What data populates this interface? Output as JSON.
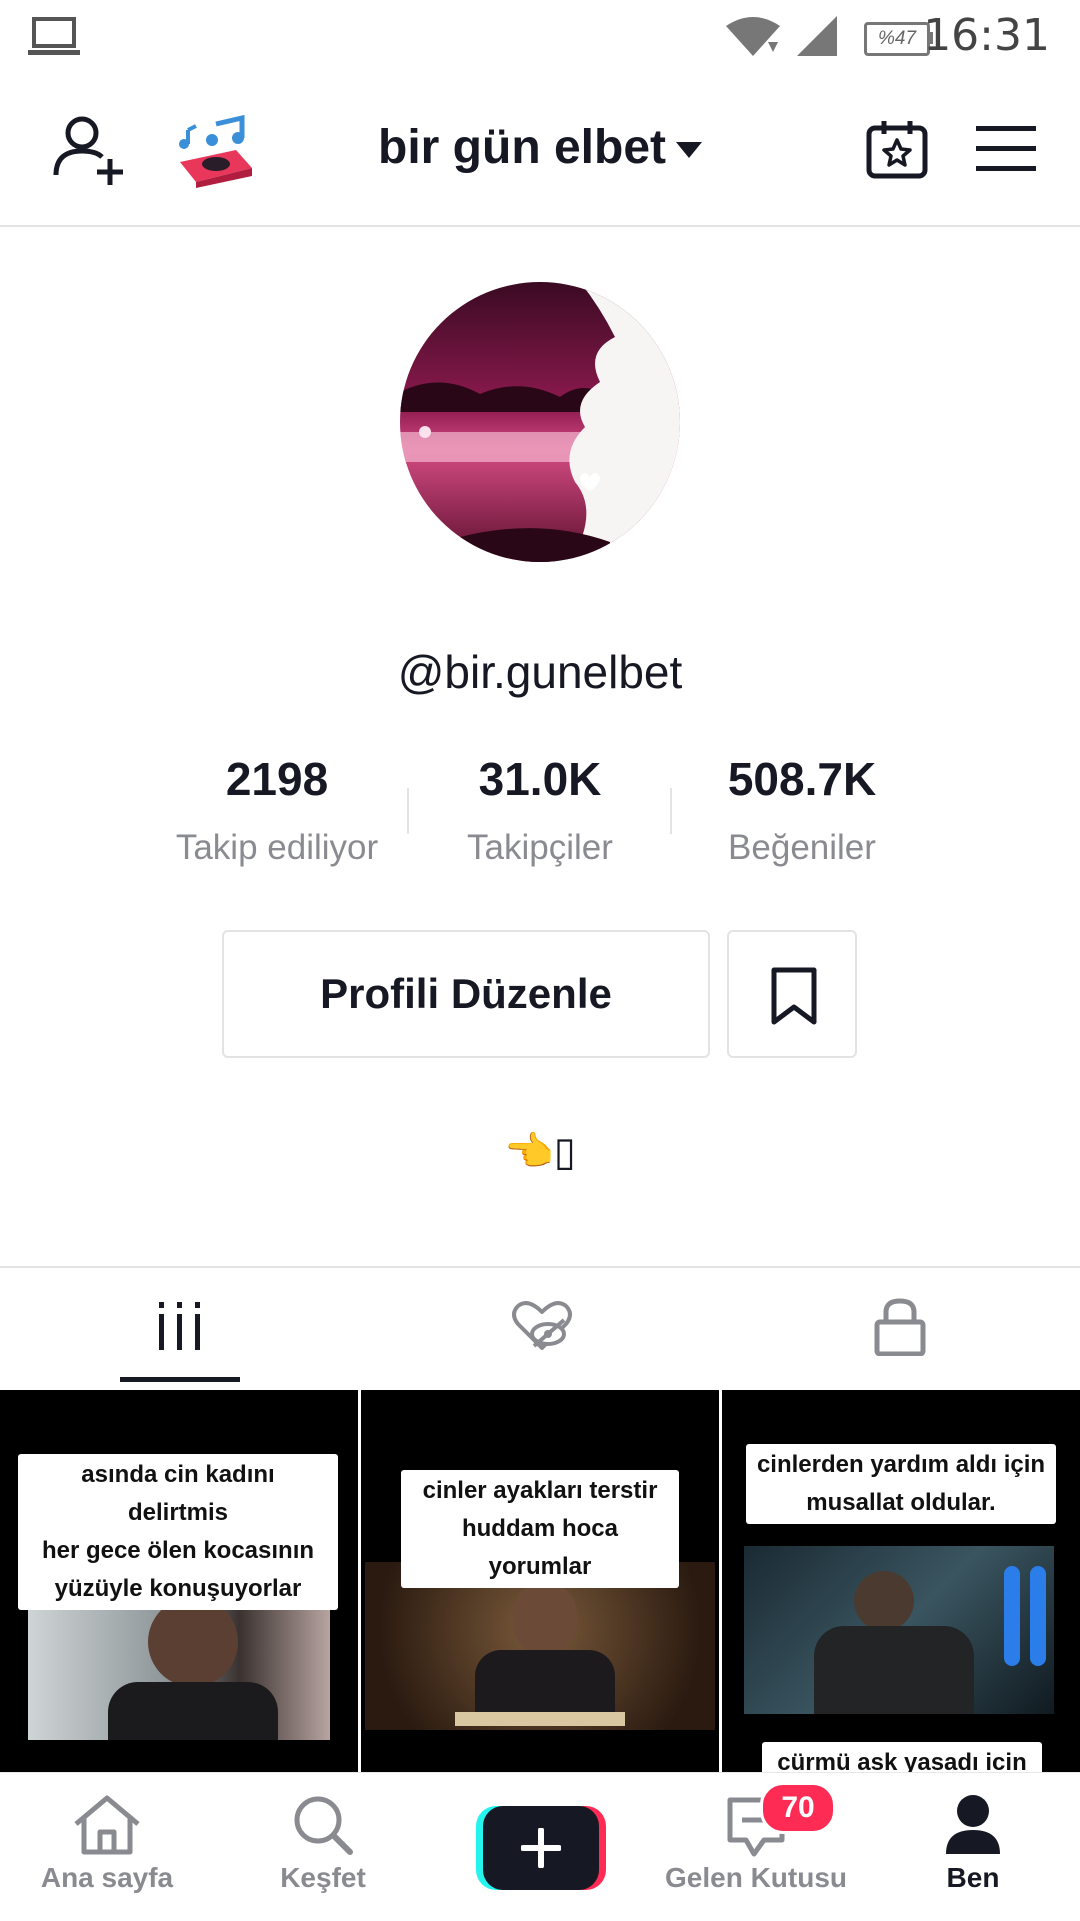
{
  "status_bar": {
    "time": "16:31",
    "battery": "%47"
  },
  "header": {
    "title": "bir gün elbet"
  },
  "profile": {
    "handle": "@bir.gunelbet",
    "stats": [
      {
        "value": "2198",
        "label": "Takip ediliyor"
      },
      {
        "value": "31.0K",
        "label": "Takipçiler"
      },
      {
        "value": "508.7K",
        "label": "Beğeniler"
      }
    ],
    "edit_label": "Profili Düzenle",
    "bio": "👈▯"
  },
  "videos": [
    {
      "caption_lines": [
        "asında cin kadını delirtmis",
        "her gece ölen kocasının",
        "yüzüyle konuşuyorlar"
      ]
    },
    {
      "caption_lines": [
        "cinler ayakları terstir",
        "huddam hoca yorumlar"
      ]
    },
    {
      "caption_lines": [
        "cinlerden yardım aldı için",
        "musallat oldular."
      ],
      "caption_bottom": "cürmü ask yasadı icin"
    }
  ],
  "bottom_nav": {
    "home": "Ana sayfa",
    "discover": "Keşfet",
    "inbox": "Gelen Kutusu",
    "inbox_badge": "70",
    "me": "Ben"
  },
  "colors": {
    "accent": "#fe2c55",
    "cyan": "#25f4ee",
    "text": "#161823",
    "muted": "#8a8b91"
  },
  "icons": [
    "laptop-icon",
    "wifi-icon",
    "signal-icon",
    "add-friend-icon",
    "music-player-icon",
    "calendar-star-icon",
    "menu-icon",
    "bookmark-icon",
    "grid-icon",
    "liked-hidden-icon",
    "lock-icon",
    "home-icon",
    "search-icon",
    "plus-icon",
    "inbox-icon",
    "profile-icon"
  ]
}
